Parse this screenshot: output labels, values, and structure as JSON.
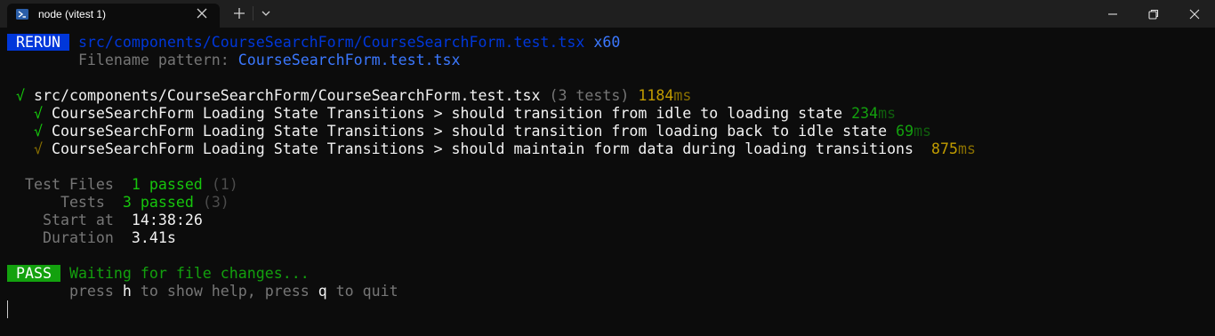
{
  "tab": {
    "title": "node (vitest 1)",
    "icon": "powershell-icon"
  },
  "titlebar": {
    "new_tab_icon": "plus-icon",
    "dropdown_icon": "chevron-down-icon",
    "minimize_icon": "minimize-icon",
    "maximize_icon": "restore-icon",
    "close_icon": "close-icon"
  },
  "colors": {
    "background": "#0c0c0c",
    "titlebar": "#1f1f1f",
    "rerun_badge": "#0037da",
    "pass_badge": "#13a10e",
    "green": "#16c60c",
    "yellow": "#c19c00",
    "dim": "#767676"
  },
  "rerun": {
    "badge": " RERUN ",
    "path": "src/components/CourseSearchForm/CourseSearchForm.test.tsx",
    "count": "x60",
    "pattern_label": "Filename pattern: ",
    "pattern_value": "CourseSearchForm.test.tsx"
  },
  "suite": {
    "check": "√",
    "file": "src/components/CourseSearchForm/CourseSearchForm.test.tsx",
    "tests_count": "(3 tests)",
    "duration_value": "1184",
    "duration_unit": "ms"
  },
  "tests": [
    {
      "check": "√",
      "name": "CourseSearchForm Loading State Transitions > should transition from idle to loading state",
      "duration_value": "234",
      "duration_unit": "ms"
    },
    {
      "check": "√",
      "name": "CourseSearchForm Loading State Transitions > should transition from loading back to idle state",
      "duration_value": "69",
      "duration_unit": "ms"
    },
    {
      "check": "√",
      "name": "CourseSearchForm Loading State Transitions > should maintain form data during loading transitions",
      "duration_value": "875",
      "duration_unit": "ms"
    }
  ],
  "summary": {
    "test_files_label": "Test Files",
    "test_files_passed": "1 passed",
    "test_files_total": "(1)",
    "tests_label": "Tests",
    "tests_passed": "3 passed",
    "tests_total": "(3)",
    "start_label": "Start at",
    "start_value": "14:38:26",
    "duration_label": "Duration",
    "duration_value": "3.41s"
  },
  "status": {
    "badge": " PASS ",
    "message": "Waiting for file changes...",
    "help_press": "press ",
    "help_key": "h",
    "help_mid": " to show help, press ",
    "quit_key": "q",
    "help_end": " to quit"
  }
}
